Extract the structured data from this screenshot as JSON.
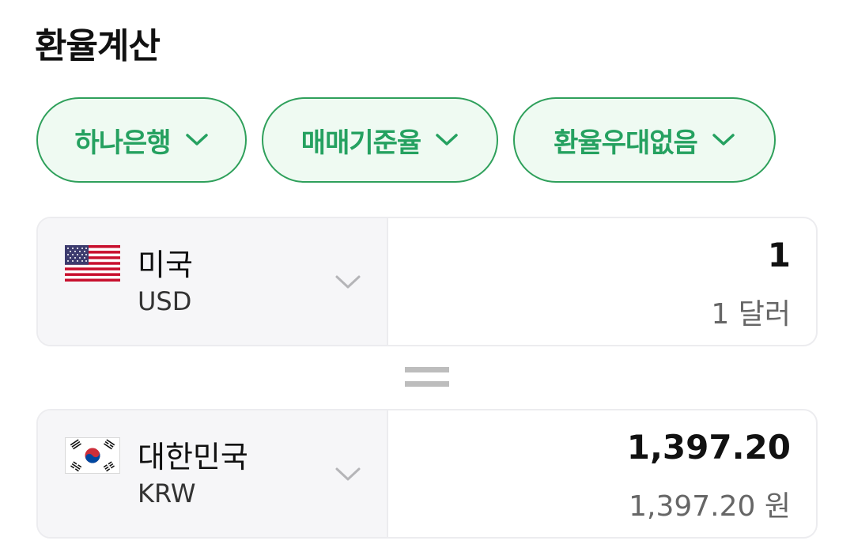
{
  "title": "환율계산",
  "filters": [
    {
      "label": "하나은행",
      "icon": "chevron-down-icon"
    },
    {
      "label": "매매기준율",
      "icon": "chevron-down-icon"
    },
    {
      "label": "환율우대없음",
      "icon": "chevron-down-icon"
    }
  ],
  "from": {
    "country": "미국",
    "currency": "USD",
    "amount": "1",
    "amount_text": "1 달러",
    "flag_icon": "us-flag-icon"
  },
  "equals_icon": "equals-icon",
  "to": {
    "country": "대한민국",
    "currency": "KRW",
    "amount": "1,397.20",
    "amount_text": "1,397.20 원",
    "flag_icon": "kr-flag-icon"
  },
  "colors": {
    "accent": "#25a160",
    "chip_bg": "#effaf2",
    "card_left_bg": "#f6f6f8",
    "border": "#ececef"
  }
}
